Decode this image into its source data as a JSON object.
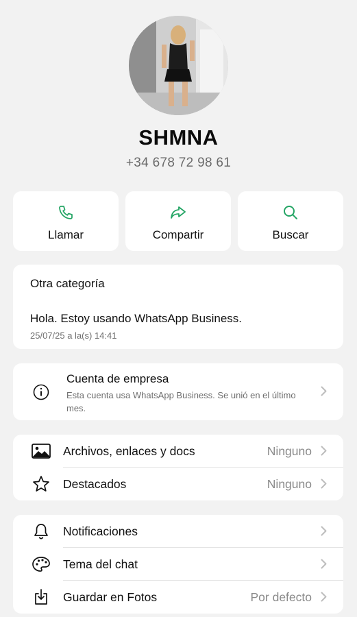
{
  "contact": {
    "name": "SHMNA",
    "phone": "+34 678 72 98 61"
  },
  "actions": [
    {
      "label": "Llamar",
      "icon": "phone-icon"
    },
    {
      "label": "Compartir",
      "icon": "share-icon"
    },
    {
      "label": "Buscar",
      "icon": "search-icon"
    }
  ],
  "info": {
    "category": "Otra categoría",
    "about": "Hola. Estoy usando WhatsApp Business.",
    "date": "25/07/25 a la(s) 14:41"
  },
  "business": {
    "title": "Cuenta de empresa",
    "description": "Esta cuenta usa WhatsApp Business. Se unió en el último mes."
  },
  "media_section": [
    {
      "label": "Archivos, enlaces y docs",
      "value": "Ninguno",
      "icon": "image-icon"
    },
    {
      "label": "Destacados",
      "value": "Ninguno",
      "icon": "star-icon"
    }
  ],
  "settings_section": [
    {
      "label": "Notificaciones",
      "value": "",
      "icon": "bell-icon"
    },
    {
      "label": "Tema del chat",
      "value": "",
      "icon": "palette-icon"
    },
    {
      "label": "Guardar en Fotos",
      "value": "Por defecto",
      "icon": "download-icon"
    }
  ],
  "colors": {
    "accent": "#25a565",
    "background": "#f2f2f2",
    "card": "#ffffff",
    "secondary_text": "#6e6e6e"
  }
}
